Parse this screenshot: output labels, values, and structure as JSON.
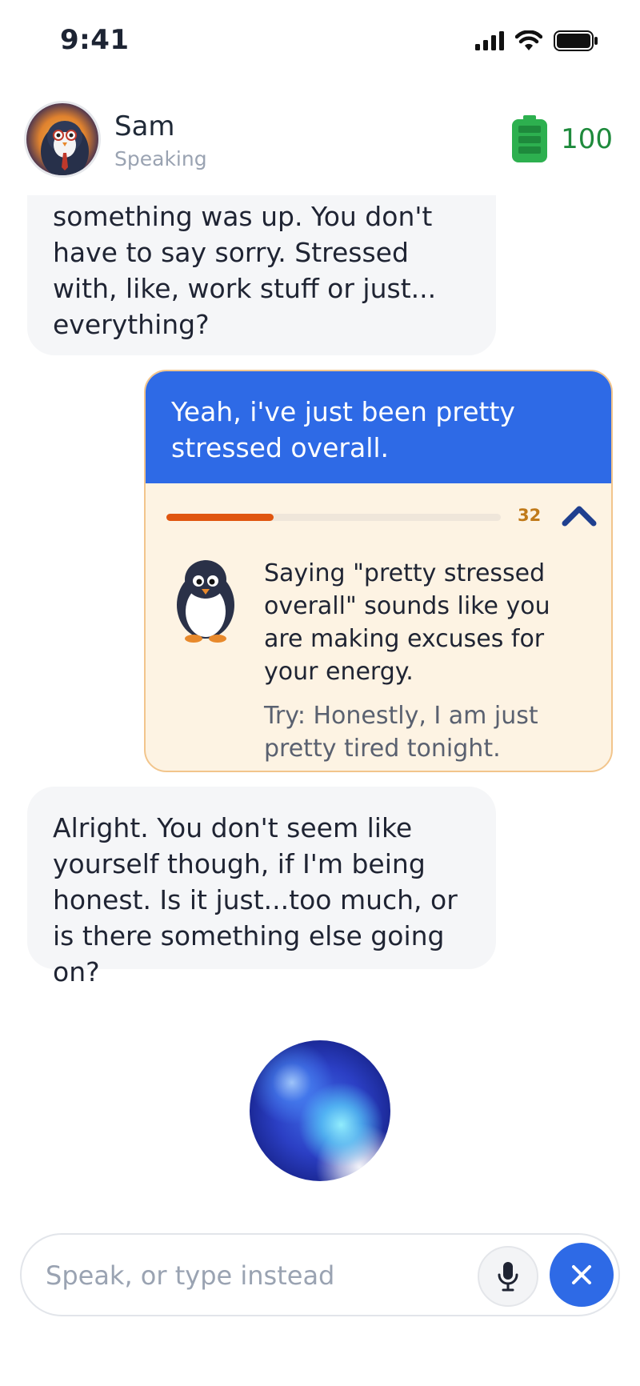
{
  "status_bar": {
    "time": "9:41"
  },
  "header": {
    "name": "Sam",
    "status": "Speaking",
    "energy_value": "100",
    "energy_color": "#2db04f"
  },
  "messages": {
    "ai_1": "something was up. You don't have to say sorry. Stressed with, like, work stuff or just... everything?",
    "user_1": "Yeah, i've just been pretty stressed overall.",
    "ai_2": "Alright. You don't seem like yourself though, if I'm being honest. Is it just...too much, or is there something else going on?"
  },
  "feedback": {
    "score": "32",
    "progress": 0.32,
    "message": "Saying \"pretty stressed overall\" sounds like you are making excuses for your energy.",
    "suggestion": "Try: Honestly, I am just pretty tired tonight."
  },
  "input": {
    "placeholder": "Speak, or type instead",
    "value": ""
  },
  "colors": {
    "accent": "#2e6ae6",
    "progress": "#e0550f",
    "card_bg": "#fdf3e3"
  }
}
